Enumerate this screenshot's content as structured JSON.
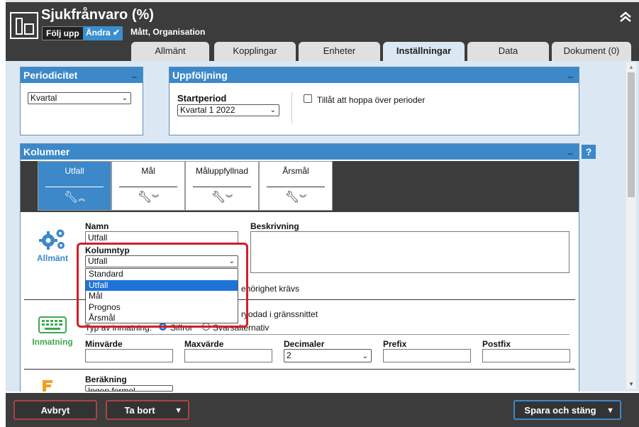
{
  "header": {
    "title": "Sjukfrånvaro (%)",
    "follow_label": "Följ upp",
    "change_label": "Ändra",
    "subtitle": "Mått, Organisation"
  },
  "tabs": [
    {
      "label": "Allmänt"
    },
    {
      "label": "Kopplingar"
    },
    {
      "label": "Enheter"
    },
    {
      "label": "Inställningar"
    },
    {
      "label": "Data"
    },
    {
      "label": "Dokument (0)"
    }
  ],
  "periodicitet": {
    "title": "Periodicitet",
    "value": "Kvartal"
  },
  "uppfoljning": {
    "title": "Uppföljning",
    "start_label": "Startperiod",
    "start_value": "Kvartal 1 2022",
    "skip_label": "Tillåt att hoppa över perioder"
  },
  "kolumner": {
    "title": "Kolumner",
    "help": "?",
    "tabs": [
      {
        "label": "Utfall"
      },
      {
        "label": "Mål"
      },
      {
        "label": "Måluppfyllnad"
      },
      {
        "label": "Årsmål"
      }
    ],
    "allmant": {
      "icon_label": "Allmänt",
      "name_label": "Namn",
      "name_value": "Utfall",
      "type_label": "Kolumntyp",
      "type_value": "Utfall",
      "type_options": [
        "Standard",
        "Utfall",
        "Mål",
        "Prognos",
        "Årsmål"
      ],
      "desc_label": "Beskrivning",
      "behorighet_text": "ehörighet krävs"
    },
    "inmatning": {
      "icon_label": "Inmatning",
      "visa_text": "ryodad i gränssnittet",
      "typ_label": "Typ av inmatning:",
      "opt_siffror": "Siffror",
      "opt_svar": "Svarsalternativ",
      "min_label": "Minvärde",
      "max_label": "Maxvärde",
      "dec_label": "Decimaler",
      "dec_value": "2",
      "prefix_label": "Prefix",
      "postfix_label": "Postfix"
    },
    "berakning": {
      "label": "Beräkning",
      "value": "Ingen formel"
    }
  },
  "footer": {
    "cancel_label": "Avbryt",
    "delete_label": "Ta bort",
    "save_label": "Spara och stäng"
  },
  "colors": {
    "accent": "#3c88c9",
    "header_bg": "#3c3c3c",
    "content_bg": "#dbe7f3",
    "highlight": "#d21f26",
    "inmatning_green": "#3aaa4f",
    "berakning_orange": "#f0a020"
  }
}
